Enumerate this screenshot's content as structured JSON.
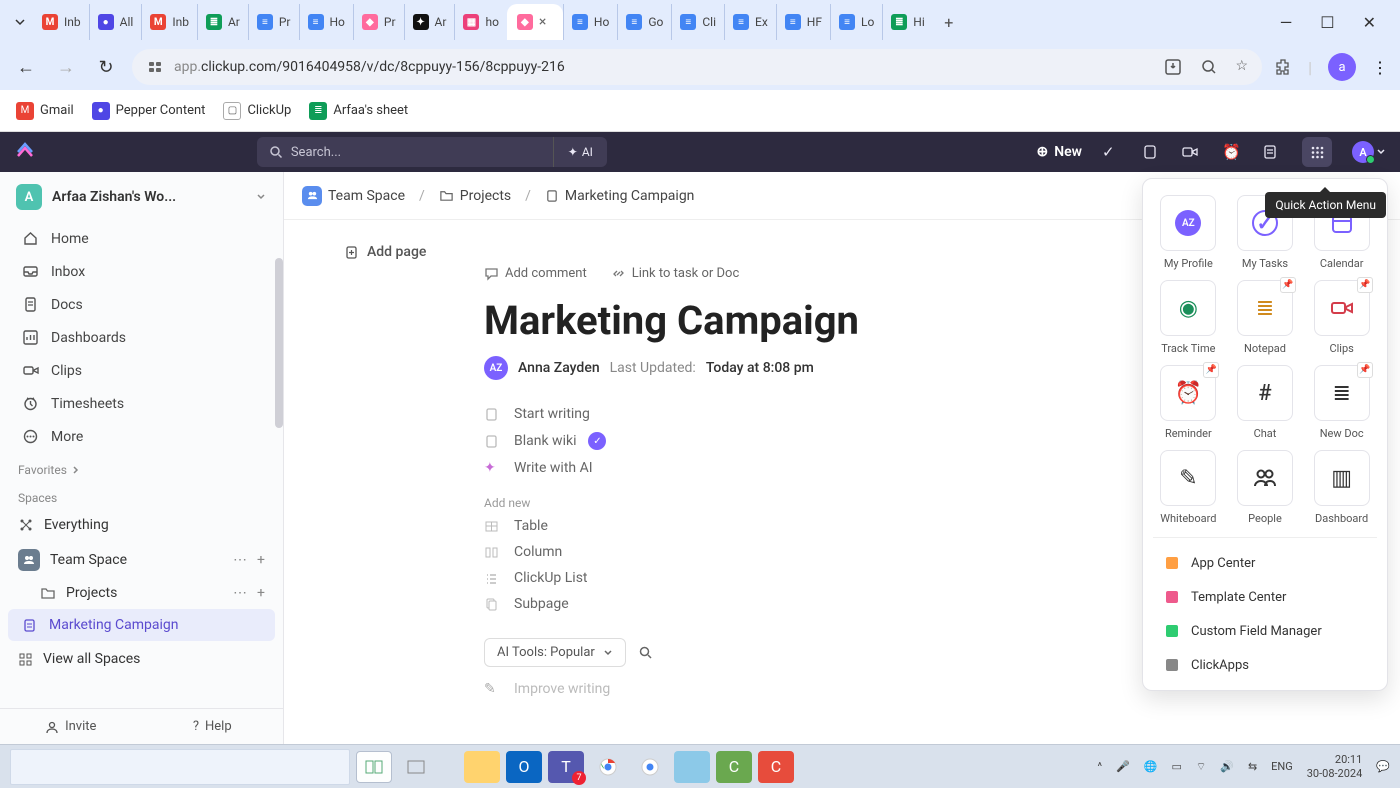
{
  "browser": {
    "tabs": [
      {
        "icon_bg": "#ea4335",
        "icon_txt": "M",
        "label": "Inb"
      },
      {
        "icon_bg": "#4f46e5",
        "icon_txt": "●",
        "label": "All"
      },
      {
        "icon_bg": "#ea4335",
        "icon_txt": "M",
        "label": "Inb"
      },
      {
        "icon_bg": "#0f9d58",
        "icon_txt": "≣",
        "label": "Ar"
      },
      {
        "icon_bg": "#4285f4",
        "icon_txt": "≡",
        "label": "Pr"
      },
      {
        "icon_bg": "#4285f4",
        "icon_txt": "≡",
        "label": "Ho"
      },
      {
        "icon_bg": "#ff6b9d",
        "icon_txt": "◆",
        "label": "Pr"
      },
      {
        "icon_bg": "#111",
        "icon_txt": "✦",
        "label": "Ar"
      },
      {
        "icon_bg": "#ec407a",
        "icon_txt": "▦",
        "label": "ho"
      },
      {
        "icon_bg": "#ff6b9d",
        "icon_txt": "◆",
        "label": "",
        "active": true
      },
      {
        "icon_bg": "#4285f4",
        "icon_txt": "≡",
        "label": "Ho"
      },
      {
        "icon_bg": "#4285f4",
        "icon_txt": "≡",
        "label": "Go"
      },
      {
        "icon_bg": "#4285f4",
        "icon_txt": "≡",
        "label": "Cli"
      },
      {
        "icon_bg": "#4285f4",
        "icon_txt": "≡",
        "label": "Ex"
      },
      {
        "icon_bg": "#4285f4",
        "icon_txt": "≡",
        "label": "HF"
      },
      {
        "icon_bg": "#4285f4",
        "icon_txt": "≡",
        "label": "Lo"
      },
      {
        "icon_bg": "#0f9d58",
        "icon_txt": "≣",
        "label": "Hi"
      }
    ],
    "url_prefix": "app.",
    "url_rest": "clickup.com/9016404958/v/dc/8cppuyy-156/8cppuyy-216",
    "bookmarks": [
      {
        "bg": "#ea4335",
        "txt": "M",
        "label": "Gmail"
      },
      {
        "bg": "#4f46e5",
        "txt": "●",
        "label": "Pepper Content"
      },
      {
        "bg": "#fff",
        "txt": "▢",
        "label": "ClickUp",
        "ring": true
      },
      {
        "bg": "#0f9d58",
        "txt": "≣",
        "label": "Arfaa's sheet"
      }
    ],
    "avatar": "a"
  },
  "app_header": {
    "search_placeholder": "Search...",
    "ai_label": "AI",
    "new_label": "New"
  },
  "sidebar": {
    "workspace": "Arfaa Zishan's Wo...",
    "ws_initial": "A",
    "items": [
      {
        "label": "Home",
        "icon": "home"
      },
      {
        "label": "Inbox",
        "icon": "inbox"
      },
      {
        "label": "Docs",
        "icon": "doc"
      },
      {
        "label": "Dashboards",
        "icon": "dash"
      },
      {
        "label": "Clips",
        "icon": "clip"
      },
      {
        "label": "Timesheets",
        "icon": "time"
      },
      {
        "label": "More",
        "icon": "more"
      }
    ],
    "favorites_label": "Favorites",
    "spaces_label": "Spaces",
    "everything_label": "Everything",
    "team_space_label": "Team Space",
    "projects_label": "Projects",
    "doc_label": "Marketing Campaign",
    "view_all_label": "View all Spaces",
    "invite_label": "Invite",
    "help_label": "Help"
  },
  "doc": {
    "add_page": "Add page",
    "add_comment": "Add comment",
    "link_task": "Link to task or Doc",
    "title": "Marketing Campaign",
    "author_initials": "AZ",
    "author": "Anna Zayden",
    "updated_label": "Last Updated:",
    "updated_time": "Today at 8:08 pm",
    "opts": {
      "start": "Start writing",
      "blank": "Blank wiki",
      "ai": "Write with AI"
    },
    "add_new": "Add new",
    "blocks": {
      "table": "Table",
      "column": "Column",
      "list": "ClickUp List",
      "subpage": "Subpage"
    },
    "ai_tools": "AI Tools: Popular",
    "improve": "Improve writing"
  },
  "breadcrumb": {
    "team": "Team Space",
    "projects": "Projects",
    "doc": "Marketing Campaign"
  },
  "quick_actions": {
    "tooltip": "Quick Action Menu",
    "grid": [
      {
        "label": "My Profile",
        "glyph": "AZ",
        "color": "#7b61ff",
        "round": true
      },
      {
        "label": "My Tasks",
        "glyph": "✓",
        "color": "#7b61ff",
        "circle": true
      },
      {
        "label": "Calendar",
        "glyph": "☐",
        "color": "#7b61ff",
        "cal": true
      },
      {
        "label": "Track Time",
        "glyph": "◉",
        "color": "#1b8f5a",
        "pin": false
      },
      {
        "label": "Notepad",
        "glyph": "≣",
        "color": "#d08a1e",
        "pin": true
      },
      {
        "label": "Clips",
        "glyph": "▢",
        "color": "#d43d4b",
        "pin": true,
        "video": true
      },
      {
        "label": "Reminder",
        "glyph": "⏰",
        "color": "#333",
        "pin": true
      },
      {
        "label": "Chat",
        "glyph": "#",
        "color": "#333"
      },
      {
        "label": "New Doc",
        "glyph": "≣",
        "color": "#333",
        "pin": true
      },
      {
        "label": "Whiteboard",
        "glyph": "✎",
        "color": "#333"
      },
      {
        "label": "People",
        "glyph": "👥",
        "color": "#333",
        "people": true
      },
      {
        "label": "Dashboard",
        "glyph": "▥",
        "color": "#333"
      }
    ],
    "list": [
      {
        "label": "App Center",
        "color": "#ff9f43"
      },
      {
        "label": "Template Center",
        "color": "#ee5a8c"
      },
      {
        "label": "Custom Field Manager",
        "color": "#2ecc71"
      },
      {
        "label": "ClickApps",
        "color": "#888"
      }
    ]
  },
  "taskbar": {
    "lang": "ENG",
    "time": "20:11",
    "date": "30-08-2024"
  }
}
